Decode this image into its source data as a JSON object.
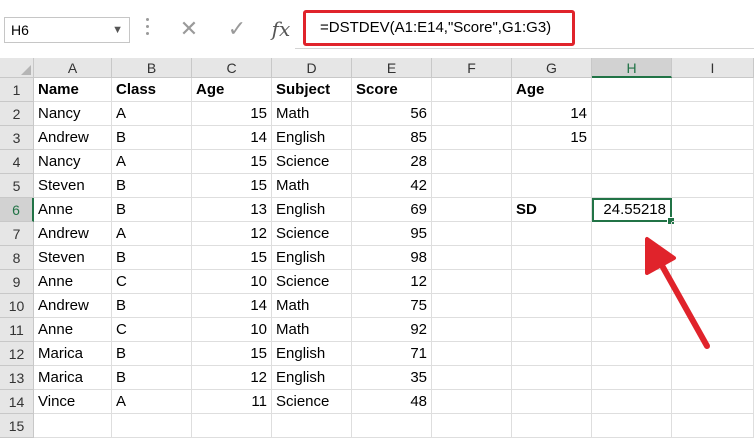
{
  "namebox": {
    "value": "H6",
    "icon": "chevron-down-icon"
  },
  "formula_bar": {
    "cancel_icon": "✕",
    "enter_icon": "✓",
    "fx_label": "fx",
    "formula": "=DSTDEV(A1:E14,\"Score\",G1:G3)"
  },
  "columns": [
    "A",
    "B",
    "C",
    "D",
    "E",
    "F",
    "G",
    "H",
    "I"
  ],
  "selected_column": "H",
  "selected_row": 6,
  "rows": [
    {
      "n": "1",
      "A": "Name",
      "B": "Class",
      "C": "Age",
      "D": "Subject",
      "E": "Score",
      "F": "",
      "G": "Age",
      "H": ""
    },
    {
      "n": "2",
      "A": "Nancy",
      "B": "A",
      "C": "15",
      "D": "Math",
      "E": "56",
      "F": "",
      "G": "14",
      "H": ""
    },
    {
      "n": "3",
      "A": "Andrew",
      "B": "B",
      "C": "14",
      "D": "English",
      "E": "85",
      "F": "",
      "G": "15",
      "H": ""
    },
    {
      "n": "4",
      "A": "Nancy",
      "B": "A",
      "C": "15",
      "D": "Science",
      "E": "28",
      "F": "",
      "G": "",
      "H": ""
    },
    {
      "n": "5",
      "A": "Steven",
      "B": "B",
      "C": "15",
      "D": "Math",
      "E": "42",
      "F": "",
      "G": "",
      "H": ""
    },
    {
      "n": "6",
      "A": "Anne",
      "B": "B",
      "C": "13",
      "D": "English",
      "E": "69",
      "F": "",
      "G": "SD",
      "H": "24.55218"
    },
    {
      "n": "7",
      "A": "Andrew",
      "B": "A",
      "C": "12",
      "D": "Science",
      "E": "95",
      "F": "",
      "G": "",
      "H": ""
    },
    {
      "n": "8",
      "A": "Steven",
      "B": "B",
      "C": "15",
      "D": "English",
      "E": "98",
      "F": "",
      "G": "",
      "H": ""
    },
    {
      "n": "9",
      "A": "Anne",
      "B": "C",
      "C": "10",
      "D": "Science",
      "E": "12",
      "F": "",
      "G": "",
      "H": ""
    },
    {
      "n": "10",
      "A": "Andrew",
      "B": "B",
      "C": "14",
      "D": "Math",
      "E": "75",
      "F": "",
      "G": "",
      "H": ""
    },
    {
      "n": "11",
      "A": "Anne",
      "B": "C",
      "C": "10",
      "D": "Math",
      "E": "92",
      "F": "",
      "G": "",
      "H": ""
    },
    {
      "n": "12",
      "A": "Marica",
      "B": "B",
      "C": "15",
      "D": "English",
      "E": "71",
      "F": "",
      "G": "",
      "H": ""
    },
    {
      "n": "13",
      "A": "Marica",
      "B": "B",
      "C": "12",
      "D": "English",
      "E": "35",
      "F": "",
      "G": "",
      "H": ""
    },
    {
      "n": "14",
      "A": "Vince",
      "B": "A",
      "C": "11",
      "D": "Science",
      "E": "48",
      "F": "",
      "G": "",
      "H": ""
    },
    {
      "n": "15",
      "A": "",
      "B": "",
      "C": "",
      "D": "",
      "E": "",
      "F": "",
      "G": "",
      "H": ""
    }
  ],
  "colors": {
    "highlight": "#e0232b",
    "selection": "#217346",
    "arrow": "#e0232b"
  }
}
